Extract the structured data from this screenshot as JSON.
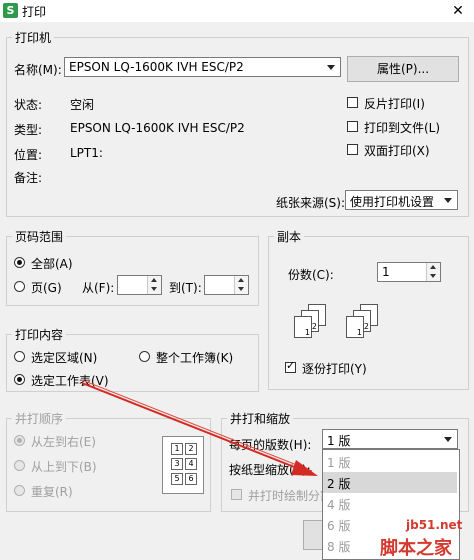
{
  "window": {
    "title": "打印",
    "close_glyph": "✕"
  },
  "printer": {
    "group_title": "打印机",
    "name_label": "名称(M):",
    "name_value": "EPSON LQ-1600K IVH ESC/P2",
    "properties_button": "属性(P)...",
    "status_label": "状态:",
    "status_value": "空闲",
    "type_label": "类型:",
    "type_value": "EPSON LQ-1600K IVH ESC/P2",
    "location_label": "位置:",
    "location_value": "LPT1:",
    "comment_label": "备注:",
    "reverse_print": "反片打印(I)",
    "print_to_file": "打印到文件(L)",
    "duplex": "双面打印(X)",
    "paper_source_label": "纸张来源(S):",
    "paper_source_value": "使用打印机设置"
  },
  "page_range": {
    "group_title": "页码范围",
    "all": "全部(A)",
    "pages": "页(G)",
    "from_label": "从(F):",
    "to_label": "到(T):",
    "from_value": "",
    "to_value": ""
  },
  "copies": {
    "group_title": "副本",
    "count_label": "份数(C):",
    "count_value": "1",
    "collate": "逐份打印(Y)",
    "stack1": [
      "1",
      "2"
    ],
    "stack2": [
      "1",
      "2"
    ]
  },
  "print_content": {
    "group_title": "打印内容",
    "selection": "选定区域(N)",
    "entire_workbook": "整个工作簿(K)",
    "selected_sheets": "选定工作表(V)"
  },
  "order": {
    "group_title": "并打顺序",
    "left_to_right": "从左到右(E)",
    "top_to_bottom": "从上到下(B)",
    "repeat": "重复(R)",
    "preview_cells": [
      "1",
      "2",
      "3",
      "4",
      "5",
      "6"
    ]
  },
  "zoom": {
    "group_title": "并打和缩放",
    "pages_per_sheet_label": "每页的版数(H):",
    "pages_per_sheet_value": "1 版",
    "scale_label": "按纸型缩放(Z):",
    "draw_borders": "并打时绘制分割",
    "options": [
      "1 版",
      "2 版",
      "4 版",
      "6 版",
      "8 版"
    ],
    "selected_option_index": 1
  },
  "watermark": {
    "site": "jb51.net",
    "brand": "脚本之家"
  },
  "colors": {
    "annotation_arrow": "#d42a24",
    "dropdown_highlight": "#d8d8d8"
  }
}
